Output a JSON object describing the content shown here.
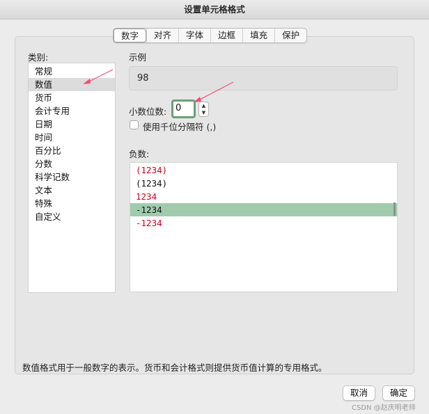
{
  "window": {
    "title": "设置单元格格式"
  },
  "tabs": [
    {
      "label": "数字",
      "active": true
    },
    {
      "label": "对齐"
    },
    {
      "label": "字体"
    },
    {
      "label": "边框"
    },
    {
      "label": "填充"
    },
    {
      "label": "保护"
    }
  ],
  "category": {
    "label": "类别:",
    "items": [
      "常规",
      "数值",
      "货币",
      "会计专用",
      "日期",
      "时间",
      "百分比",
      "分数",
      "科学记数",
      "文本",
      "特殊",
      "自定义"
    ],
    "selected": "数值"
  },
  "sample": {
    "label": "示例",
    "value": "98"
  },
  "decimal": {
    "label": "小数位数:",
    "value": "0"
  },
  "thousands": {
    "label": "使用千位分隔符 (,)",
    "checked": false
  },
  "negative": {
    "label": "负数:",
    "items": [
      {
        "text": "(1234)",
        "color": "#d0021b"
      },
      {
        "text": "(1234)",
        "color": "#111111"
      },
      {
        "text": "1234",
        "color": "#d0021b"
      },
      {
        "text": "-1234",
        "color": "#111111",
        "selected": true
      },
      {
        "text": "-1234",
        "color": "#d0021b"
      }
    ]
  },
  "description": "数值格式用于一般数字的表示。货币和会计格式则提供货币值计算的专用格式。",
  "buttons": {
    "cancel": "取消",
    "ok": "确定"
  },
  "watermark": "CSDN @赵庆明老师",
  "colors": {
    "accent_green": "#a1cbad",
    "annotation_arrow": "#f0506e"
  }
}
